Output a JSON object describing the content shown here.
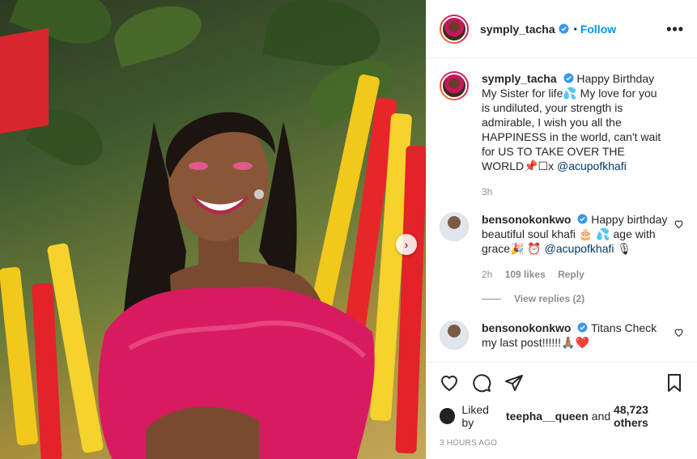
{
  "post": {
    "username": "symply_tacha",
    "follow_label": "Follow",
    "separator": "•",
    "more_label": "•••"
  },
  "caption": {
    "username": "symply_tacha",
    "text": "Happy Birthday My Sister for life💦 My love for you is undiluted, your strength is admirable, I wish you all the HAPPINESS in the world, can't wait for US TO TAKE OVER THE WORLD📌☐x",
    "mention": "@acupofkhafi",
    "time": "3h"
  },
  "comments": [
    {
      "username": "bensonokonkwo",
      "text": "Happy birthday beautiful soul khafi 🎂 💦 age with grace🎉 ⏰",
      "mention": "@acupofkhafi",
      "mention_suffix": " 🎙",
      "time": "2h",
      "likes": "109 likes",
      "reply_label": "Reply",
      "view_replies": "View replies (2)"
    },
    {
      "username": "bensonokonkwo",
      "text": "Titans Check my last post!!!!!!🙏🏽❤️"
    }
  ],
  "likes": {
    "prefix": "Liked by",
    "user": "teepha__queen",
    "middle": "and",
    "count": "48,723 others"
  },
  "posted_time": "3 HOURS AGO",
  "colors": {
    "accent": "#0095f6",
    "verified": "#3897f0",
    "dress": "#d81b60"
  }
}
